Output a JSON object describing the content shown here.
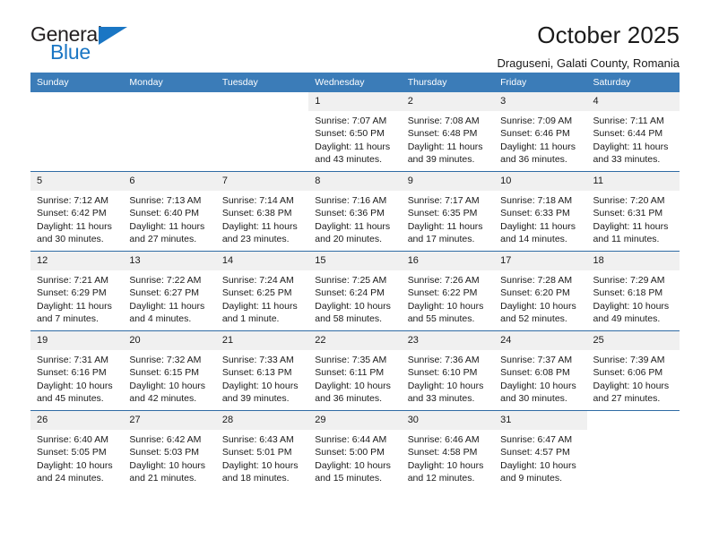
{
  "brand": {
    "name_top": "General",
    "name_bottom": "Blue",
    "accent_color": "#1a76c4"
  },
  "header": {
    "title": "October 2025",
    "subtitle": "Draguseni, Galati County, Romania"
  },
  "theme": {
    "header_row_bg": "#3b7cb8",
    "cell_header_bg": "#f0f0f0",
    "grid_line": "#2f6ba4"
  },
  "weekdays": [
    "Sunday",
    "Monday",
    "Tuesday",
    "Wednesday",
    "Thursday",
    "Friday",
    "Saturday"
  ],
  "weeks": [
    [
      {
        "day": "",
        "blank": true,
        "sunrise": "",
        "sunset": "",
        "daylight1": "",
        "daylight2": ""
      },
      {
        "day": "",
        "blank": true,
        "sunrise": "",
        "sunset": "",
        "daylight1": "",
        "daylight2": ""
      },
      {
        "day": "",
        "blank": true,
        "sunrise": "",
        "sunset": "",
        "daylight1": "",
        "daylight2": ""
      },
      {
        "day": "1",
        "sunrise": "Sunrise: 7:07 AM",
        "sunset": "Sunset: 6:50 PM",
        "daylight1": "Daylight: 11 hours",
        "daylight2": "and 43 minutes."
      },
      {
        "day": "2",
        "sunrise": "Sunrise: 7:08 AM",
        "sunset": "Sunset: 6:48 PM",
        "daylight1": "Daylight: 11 hours",
        "daylight2": "and 39 minutes."
      },
      {
        "day": "3",
        "sunrise": "Sunrise: 7:09 AM",
        "sunset": "Sunset: 6:46 PM",
        "daylight1": "Daylight: 11 hours",
        "daylight2": "and 36 minutes."
      },
      {
        "day": "4",
        "sunrise": "Sunrise: 7:11 AM",
        "sunset": "Sunset: 6:44 PM",
        "daylight1": "Daylight: 11 hours",
        "daylight2": "and 33 minutes."
      }
    ],
    [
      {
        "day": "5",
        "sunrise": "Sunrise: 7:12 AM",
        "sunset": "Sunset: 6:42 PM",
        "daylight1": "Daylight: 11 hours",
        "daylight2": "and 30 minutes."
      },
      {
        "day": "6",
        "sunrise": "Sunrise: 7:13 AM",
        "sunset": "Sunset: 6:40 PM",
        "daylight1": "Daylight: 11 hours",
        "daylight2": "and 27 minutes."
      },
      {
        "day": "7",
        "sunrise": "Sunrise: 7:14 AM",
        "sunset": "Sunset: 6:38 PM",
        "daylight1": "Daylight: 11 hours",
        "daylight2": "and 23 minutes."
      },
      {
        "day": "8",
        "sunrise": "Sunrise: 7:16 AM",
        "sunset": "Sunset: 6:36 PM",
        "daylight1": "Daylight: 11 hours",
        "daylight2": "and 20 minutes."
      },
      {
        "day": "9",
        "sunrise": "Sunrise: 7:17 AM",
        "sunset": "Sunset: 6:35 PM",
        "daylight1": "Daylight: 11 hours",
        "daylight2": "and 17 minutes."
      },
      {
        "day": "10",
        "sunrise": "Sunrise: 7:18 AM",
        "sunset": "Sunset: 6:33 PM",
        "daylight1": "Daylight: 11 hours",
        "daylight2": "and 14 minutes."
      },
      {
        "day": "11",
        "sunrise": "Sunrise: 7:20 AM",
        "sunset": "Sunset: 6:31 PM",
        "daylight1": "Daylight: 11 hours",
        "daylight2": "and 11 minutes."
      }
    ],
    [
      {
        "day": "12",
        "sunrise": "Sunrise: 7:21 AM",
        "sunset": "Sunset: 6:29 PM",
        "daylight1": "Daylight: 11 hours",
        "daylight2": "and 7 minutes."
      },
      {
        "day": "13",
        "sunrise": "Sunrise: 7:22 AM",
        "sunset": "Sunset: 6:27 PM",
        "daylight1": "Daylight: 11 hours",
        "daylight2": "and 4 minutes."
      },
      {
        "day": "14",
        "sunrise": "Sunrise: 7:24 AM",
        "sunset": "Sunset: 6:25 PM",
        "daylight1": "Daylight: 11 hours",
        "daylight2": "and 1 minute."
      },
      {
        "day": "15",
        "sunrise": "Sunrise: 7:25 AM",
        "sunset": "Sunset: 6:24 PM",
        "daylight1": "Daylight: 10 hours",
        "daylight2": "and 58 minutes."
      },
      {
        "day": "16",
        "sunrise": "Sunrise: 7:26 AM",
        "sunset": "Sunset: 6:22 PM",
        "daylight1": "Daylight: 10 hours",
        "daylight2": "and 55 minutes."
      },
      {
        "day": "17",
        "sunrise": "Sunrise: 7:28 AM",
        "sunset": "Sunset: 6:20 PM",
        "daylight1": "Daylight: 10 hours",
        "daylight2": "and 52 minutes."
      },
      {
        "day": "18",
        "sunrise": "Sunrise: 7:29 AM",
        "sunset": "Sunset: 6:18 PM",
        "daylight1": "Daylight: 10 hours",
        "daylight2": "and 49 minutes."
      }
    ],
    [
      {
        "day": "19",
        "sunrise": "Sunrise: 7:31 AM",
        "sunset": "Sunset: 6:16 PM",
        "daylight1": "Daylight: 10 hours",
        "daylight2": "and 45 minutes."
      },
      {
        "day": "20",
        "sunrise": "Sunrise: 7:32 AM",
        "sunset": "Sunset: 6:15 PM",
        "daylight1": "Daylight: 10 hours",
        "daylight2": "and 42 minutes."
      },
      {
        "day": "21",
        "sunrise": "Sunrise: 7:33 AM",
        "sunset": "Sunset: 6:13 PM",
        "daylight1": "Daylight: 10 hours",
        "daylight2": "and 39 minutes."
      },
      {
        "day": "22",
        "sunrise": "Sunrise: 7:35 AM",
        "sunset": "Sunset: 6:11 PM",
        "daylight1": "Daylight: 10 hours",
        "daylight2": "and 36 minutes."
      },
      {
        "day": "23",
        "sunrise": "Sunrise: 7:36 AM",
        "sunset": "Sunset: 6:10 PM",
        "daylight1": "Daylight: 10 hours",
        "daylight2": "and 33 minutes."
      },
      {
        "day": "24",
        "sunrise": "Sunrise: 7:37 AM",
        "sunset": "Sunset: 6:08 PM",
        "daylight1": "Daylight: 10 hours",
        "daylight2": "and 30 minutes."
      },
      {
        "day": "25",
        "sunrise": "Sunrise: 7:39 AM",
        "sunset": "Sunset: 6:06 PM",
        "daylight1": "Daylight: 10 hours",
        "daylight2": "and 27 minutes."
      }
    ],
    [
      {
        "day": "26",
        "sunrise": "Sunrise: 6:40 AM",
        "sunset": "Sunset: 5:05 PM",
        "daylight1": "Daylight: 10 hours",
        "daylight2": "and 24 minutes."
      },
      {
        "day": "27",
        "sunrise": "Sunrise: 6:42 AM",
        "sunset": "Sunset: 5:03 PM",
        "daylight1": "Daylight: 10 hours",
        "daylight2": "and 21 minutes."
      },
      {
        "day": "28",
        "sunrise": "Sunrise: 6:43 AM",
        "sunset": "Sunset: 5:01 PM",
        "daylight1": "Daylight: 10 hours",
        "daylight2": "and 18 minutes."
      },
      {
        "day": "29",
        "sunrise": "Sunrise: 6:44 AM",
        "sunset": "Sunset: 5:00 PM",
        "daylight1": "Daylight: 10 hours",
        "daylight2": "and 15 minutes."
      },
      {
        "day": "30",
        "sunrise": "Sunrise: 6:46 AM",
        "sunset": "Sunset: 4:58 PM",
        "daylight1": "Daylight: 10 hours",
        "daylight2": "and 12 minutes."
      },
      {
        "day": "31",
        "sunrise": "Sunrise: 6:47 AM",
        "sunset": "Sunset: 4:57 PM",
        "daylight1": "Daylight: 10 hours",
        "daylight2": "and 9 minutes."
      },
      {
        "day": "",
        "blank": true,
        "sunrise": "",
        "sunset": "",
        "daylight1": "",
        "daylight2": ""
      }
    ]
  ]
}
